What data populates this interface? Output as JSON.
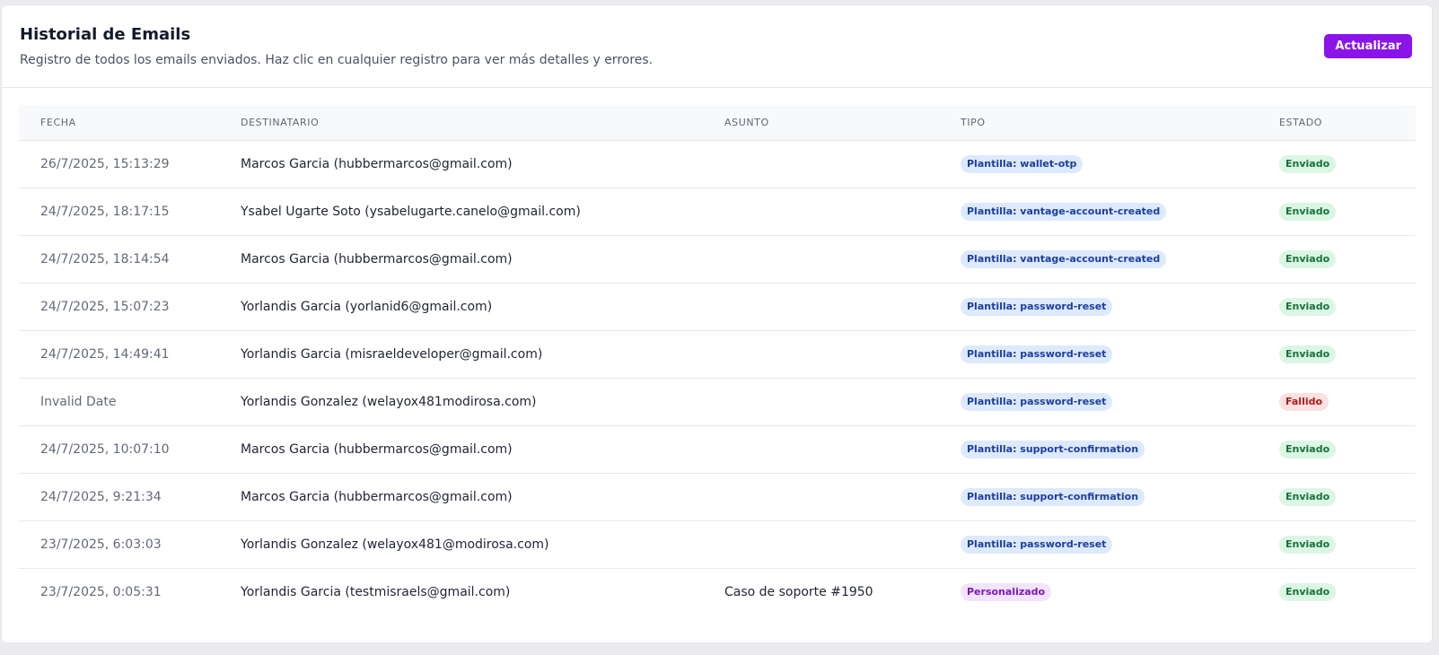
{
  "header": {
    "title": "Historial de Emails",
    "description": "Registro de todos los emails enviados. Haz clic en cualquier registro para ver más detalles y errores.",
    "refresh_label": "Actualizar"
  },
  "table": {
    "columns": [
      "FECHA",
      "DESTINATARIO",
      "ASUNTO",
      "TIPO",
      "ESTADO"
    ],
    "rows": [
      {
        "fecha": "26/7/2025, 15:13:29",
        "destinatario": "Marcos Garcia (hubbermarcos@gmail.com)",
        "asunto": "",
        "tipo": "Plantilla: wallet-otp",
        "tipo_kind": "plantilla",
        "estado": "Enviado",
        "estado_kind": "ok"
      },
      {
        "fecha": "24/7/2025, 18:17:15",
        "destinatario": "Ysabel Ugarte Soto (ysabelugarte.canelo@gmail.com)",
        "asunto": "",
        "tipo": "Plantilla: vantage-account-created",
        "tipo_kind": "plantilla",
        "estado": "Enviado",
        "estado_kind": "ok"
      },
      {
        "fecha": "24/7/2025, 18:14:54",
        "destinatario": "Marcos Garcia (hubbermarcos@gmail.com)",
        "asunto": "",
        "tipo": "Plantilla: vantage-account-created",
        "tipo_kind": "plantilla",
        "estado": "Enviado",
        "estado_kind": "ok"
      },
      {
        "fecha": "24/7/2025, 15:07:23",
        "destinatario": "Yorlandis Garcia (yorlanid6@gmail.com)",
        "asunto": "",
        "tipo": "Plantilla: password-reset",
        "tipo_kind": "plantilla",
        "estado": "Enviado",
        "estado_kind": "ok"
      },
      {
        "fecha": "24/7/2025, 14:49:41",
        "destinatario": "Yorlandis Garcia (misraeldeveloper@gmail.com)",
        "asunto": "",
        "tipo": "Plantilla: password-reset",
        "tipo_kind": "plantilla",
        "estado": "Enviado",
        "estado_kind": "ok"
      },
      {
        "fecha": "Invalid Date",
        "destinatario": "Yorlandis Gonzalez (welayox481modirosa.com)",
        "asunto": "",
        "tipo": "Plantilla: password-reset",
        "tipo_kind": "plantilla",
        "estado": "Fallido",
        "estado_kind": "fail"
      },
      {
        "fecha": "24/7/2025, 10:07:10",
        "destinatario": "Marcos Garcia (hubbermarcos@gmail.com)",
        "asunto": "",
        "tipo": "Plantilla: support-confirmation",
        "tipo_kind": "plantilla",
        "estado": "Enviado",
        "estado_kind": "ok"
      },
      {
        "fecha": "24/7/2025, 9:21:34",
        "destinatario": "Marcos Garcia (hubbermarcos@gmail.com)",
        "asunto": "",
        "tipo": "Plantilla: support-confirmation",
        "tipo_kind": "plantilla",
        "estado": "Enviado",
        "estado_kind": "ok"
      },
      {
        "fecha": "23/7/2025, 6:03:03",
        "destinatario": "Yorlandis Gonzalez (welayox481@modirosa.com)",
        "asunto": "",
        "tipo": "Plantilla: password-reset",
        "tipo_kind": "plantilla",
        "estado": "Enviado",
        "estado_kind": "ok"
      },
      {
        "fecha": "23/7/2025, 0:05:31",
        "destinatario": "Yorlandis Garcia (testmisraels@gmail.com)",
        "asunto": "Caso de soporte #1950",
        "tipo": "Personalizado",
        "tipo_kind": "custom",
        "estado": "Enviado",
        "estado_kind": "ok"
      }
    ]
  },
  "colors": {
    "accent": "#8b14e8",
    "status_ok_bg": "#dcf6e4",
    "status_ok_text": "#17723a",
    "status_fail_bg": "#fde0e0",
    "status_fail_text": "#b01a1a",
    "template_badge_bg": "#dde9fd",
    "template_badge_text": "#1c3f9e",
    "custom_badge_bg": "#f3e3fd",
    "custom_badge_text": "#7c18b8"
  }
}
